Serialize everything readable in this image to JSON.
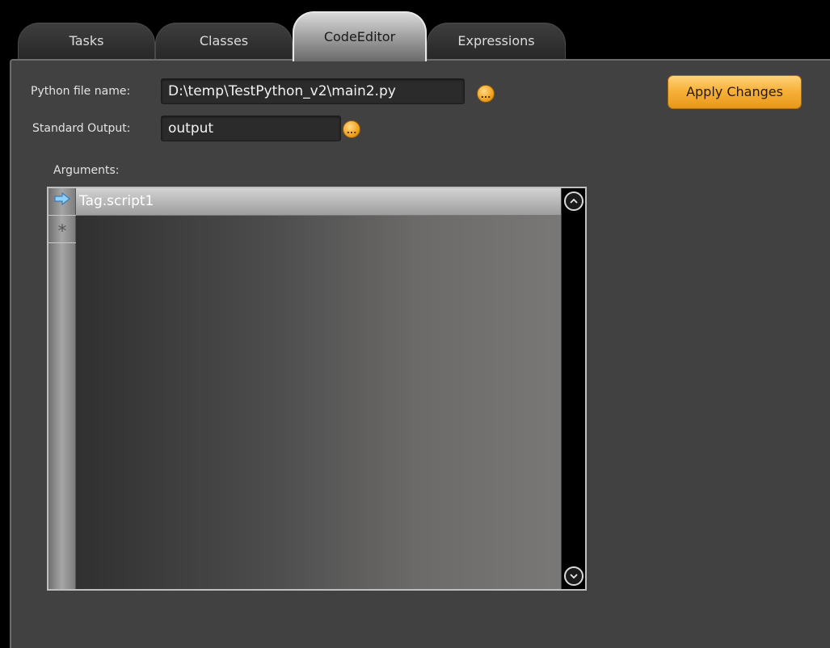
{
  "tabs": [
    {
      "label": "Tasks"
    },
    {
      "label": "Classes"
    },
    {
      "label": "CodeEditor",
      "active": true
    },
    {
      "label": "Expressions"
    }
  ],
  "form": {
    "python_file_label": "Python file name:",
    "python_file_value": "D:\\temp\\TestPython_v2\\main2.py",
    "standard_output_label": "Standard Output:",
    "standard_output_value": "output",
    "browse_glyph": "...",
    "apply_label": "Apply Changes"
  },
  "arguments": {
    "label": "Arguments:",
    "rows": [
      {
        "value": "Tag.script1",
        "indicator": "arrow-right-icon"
      }
    ],
    "new_row_indicator": "asterisk-icon"
  },
  "colors": {
    "accent_orange": "#f5a623",
    "panel_bg": "#414141",
    "tab_active": "#d9d9d9"
  }
}
